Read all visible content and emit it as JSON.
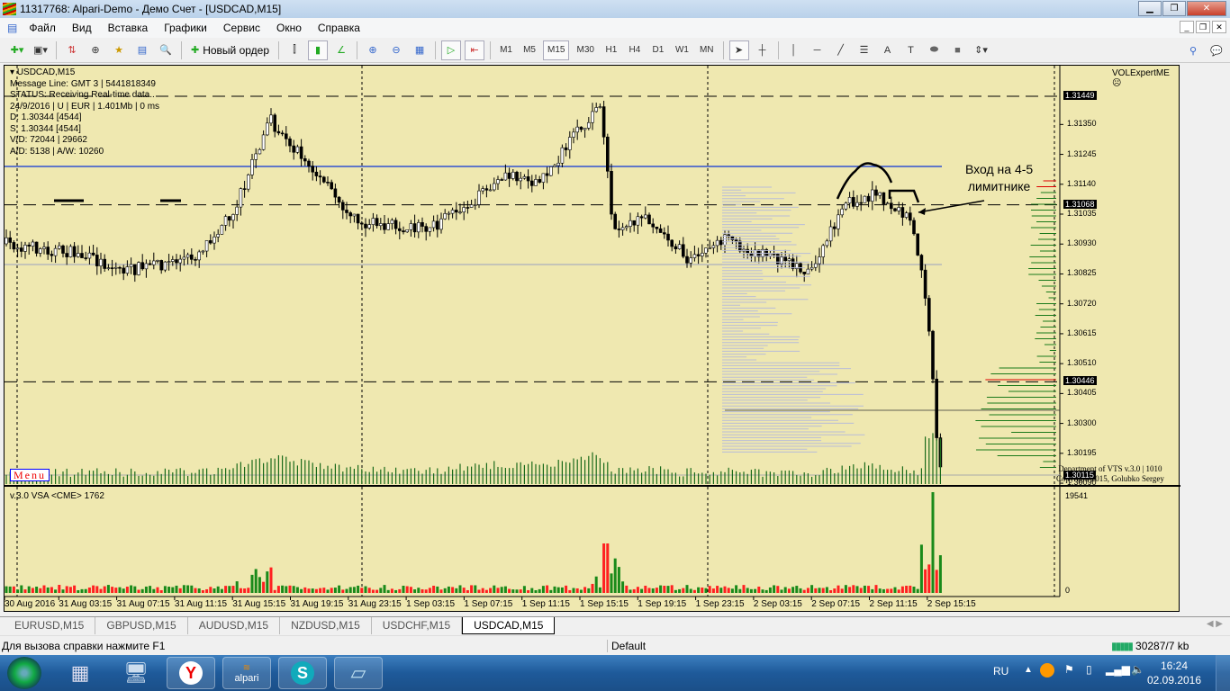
{
  "window": {
    "title": "11317768: Alpari-Demo - Демо Счет - [USDCAD,M15]"
  },
  "menu": [
    "Файл",
    "Вид",
    "Вставка",
    "Графики",
    "Сервис",
    "Окно",
    "Справка"
  ],
  "toolbar": {
    "new_order": "Новый ордер",
    "timeframes": [
      "M1",
      "M5",
      "M15",
      "M30",
      "H1",
      "H4",
      "D1",
      "W1",
      "MN"
    ],
    "selected_timeframe": "M15"
  },
  "chart": {
    "symbol": "USDCAD,M15",
    "info_lines": [
      "Message Line: GMT 3 | 5441818349",
      "STATUS:  Receiving Real-time data..",
      "24/9/2016 | U | EUR | 1.401Mb | 0 ms",
      "D: 1.30344  [4544]",
      "S: 1.30344  [4544]",
      "V/D: 72044 | 29662",
      "A/D: 5138 | A/W: 10260"
    ],
    "expert": "VOLExpertME",
    "price_ticks": [
      "1.31350",
      "1.31245",
      "1.31140",
      "1.31035",
      "1.30930",
      "1.30825",
      "1.30720",
      "1.30615",
      "1.30510",
      "1.30405",
      "1.30300",
      "1.30195",
      "1.30090"
    ],
    "price_tags": [
      "1.31449",
      "1.31068",
      "1.30446",
      "1.30115"
    ],
    "annotation": [
      "Вход на 4-5",
      "лимитнике"
    ],
    "footer": [
      "Department of VTS  v.3.0 | 1010",
      "Copyright 2015, Golubko Sergey"
    ],
    "menu_button": "Menu",
    "indicator_label": "v.3.0 VSA <CME> 1762",
    "indicator_max": "19541",
    "indicator_min": "0",
    "time_ticks": [
      "30 Aug 2016",
      "31 Aug 03:15",
      "31 Aug 07:15",
      "31 Aug 11:15",
      "31 Aug 15:15",
      "31 Aug 19:15",
      "31 Aug 23:15",
      "1 Sep 03:15",
      "1 Sep 07:15",
      "1 Sep 11:15",
      "1 Sep 15:15",
      "1 Sep 19:15",
      "1 Sep 23:15",
      "2 Sep 03:15",
      "2 Sep 07:15",
      "2 Sep 11:15",
      "2 Sep 15:15"
    ],
    "colors": {
      "background": "#efe8b0",
      "up_volume": "#1a8a1a",
      "down_volume": "#ff2020",
      "resistance": "#3050d0"
    }
  },
  "tabs": [
    "EURUSD,M15",
    "GBPUSD,M15",
    "AUDUSD,M15",
    "NZDUSD,M15",
    "USDCHF,M15",
    "USDCAD,M15"
  ],
  "active_tab": "USDCAD,M15",
  "status": {
    "help": "Для вызова справки нажмите F1",
    "profile": "Default",
    "traffic": "30287/7 kb"
  },
  "taskbar": {
    "lang": "RU",
    "time": "16:24",
    "date": "02.09.2016",
    "alpari": "alpari"
  }
}
